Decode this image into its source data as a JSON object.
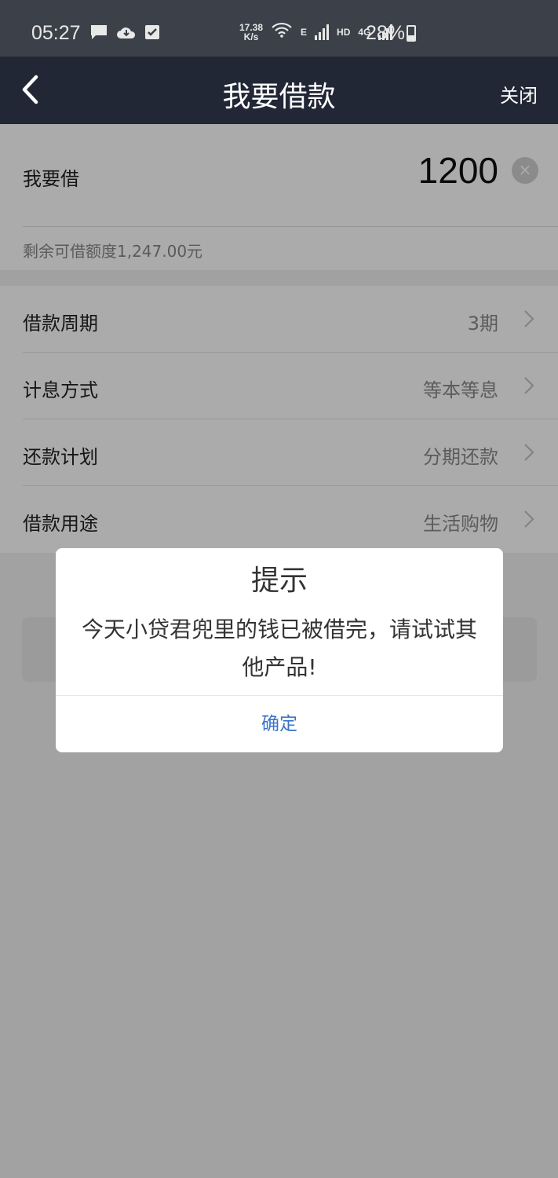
{
  "status_bar": {
    "time": "05:27",
    "speed_value": "17.38",
    "speed_unit": "K/s",
    "network_e": "E",
    "network_hd": "HD",
    "network_4g": "4G",
    "battery": "28%",
    "icons": [
      "message-icon",
      "cloud-icon",
      "checkbox-icon",
      "wifi-icon",
      "signal-icon",
      "battery-icon"
    ]
  },
  "header": {
    "title": "我要借款",
    "close_label": "关闭"
  },
  "amount": {
    "label": "我要借",
    "value": "1200",
    "remaining": "剩余可借额度1,247.00元"
  },
  "options": [
    {
      "label": "借款周期",
      "value": "3期"
    },
    {
      "label": "计息方式",
      "value": "等本等息"
    },
    {
      "label": "还款计划",
      "value": "分期还款"
    },
    {
      "label": "借款用途",
      "value": "生活购物"
    }
  ],
  "dialog": {
    "title": "提示",
    "message": "今天小贷君兜里的钱已被借完，请试试其他产品!",
    "confirm_label": "确定"
  },
  "colors": {
    "nav_bg": "#222736",
    "status_bg": "#3c4149",
    "link_blue": "#3a74c9"
  }
}
